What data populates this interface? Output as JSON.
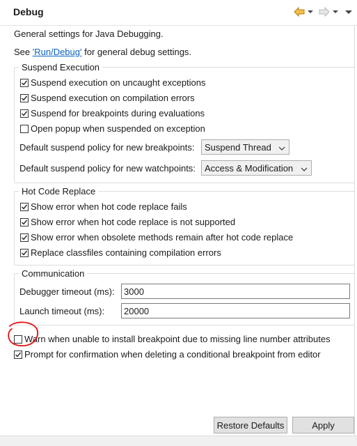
{
  "header": {
    "title": "Debug",
    "icons": [
      "back-arrow-icon",
      "dropdown-chevron-icon",
      "forward-arrow-icon",
      "dropdown-chevron-icon",
      "view-menu-icon"
    ],
    "accent_color": "#e2a21b"
  },
  "intro": {
    "line1": "General settings for Java Debugging.",
    "line2_prefix": "See ",
    "line2_link": "'Run/Debug'",
    "line2_suffix": " for general debug settings."
  },
  "suspend": {
    "legend": "Suspend Execution",
    "checks": [
      {
        "label": "Suspend execution on uncaught exceptions",
        "checked": true
      },
      {
        "label": "Suspend execution on compilation errors",
        "checked": true
      },
      {
        "label": "Suspend for breakpoints during evaluations",
        "checked": true
      },
      {
        "label": "Open popup when suspended on exception",
        "checked": false
      }
    ],
    "bp_policy_label": "Default suspend policy for new breakpoints:",
    "bp_policy_value": "Suspend Thread",
    "wp_policy_label": "Default suspend policy for new watchpoints:",
    "wp_policy_value": "Access & Modification"
  },
  "hcr": {
    "legend": "Hot Code Replace",
    "checks": [
      {
        "label": "Show error when hot code replace fails",
        "checked": true
      },
      {
        "label": "Show error when hot code replace is not supported",
        "checked": true
      },
      {
        "label": "Show error when obsolete methods remain after hot code replace",
        "checked": true
      },
      {
        "label": "Replace classfiles containing compilation errors",
        "checked": true
      }
    ]
  },
  "communication": {
    "legend": "Communication",
    "debugger_timeout_label": "Debugger timeout (ms):",
    "debugger_timeout_value": "3000",
    "launch_timeout_label": "Launch timeout (ms):",
    "launch_timeout_value": "20000"
  },
  "extra": {
    "checks": [
      {
        "label": "Warn when unable to install breakpoint due to missing line number attributes",
        "checked": false
      },
      {
        "label": "Prompt for confirmation when deleting a conditional breakpoint from editor",
        "checked": true
      }
    ],
    "annotation_color": "#e01010"
  },
  "buttons": {
    "restore_defaults": "Restore Defaults",
    "apply": "Apply"
  }
}
